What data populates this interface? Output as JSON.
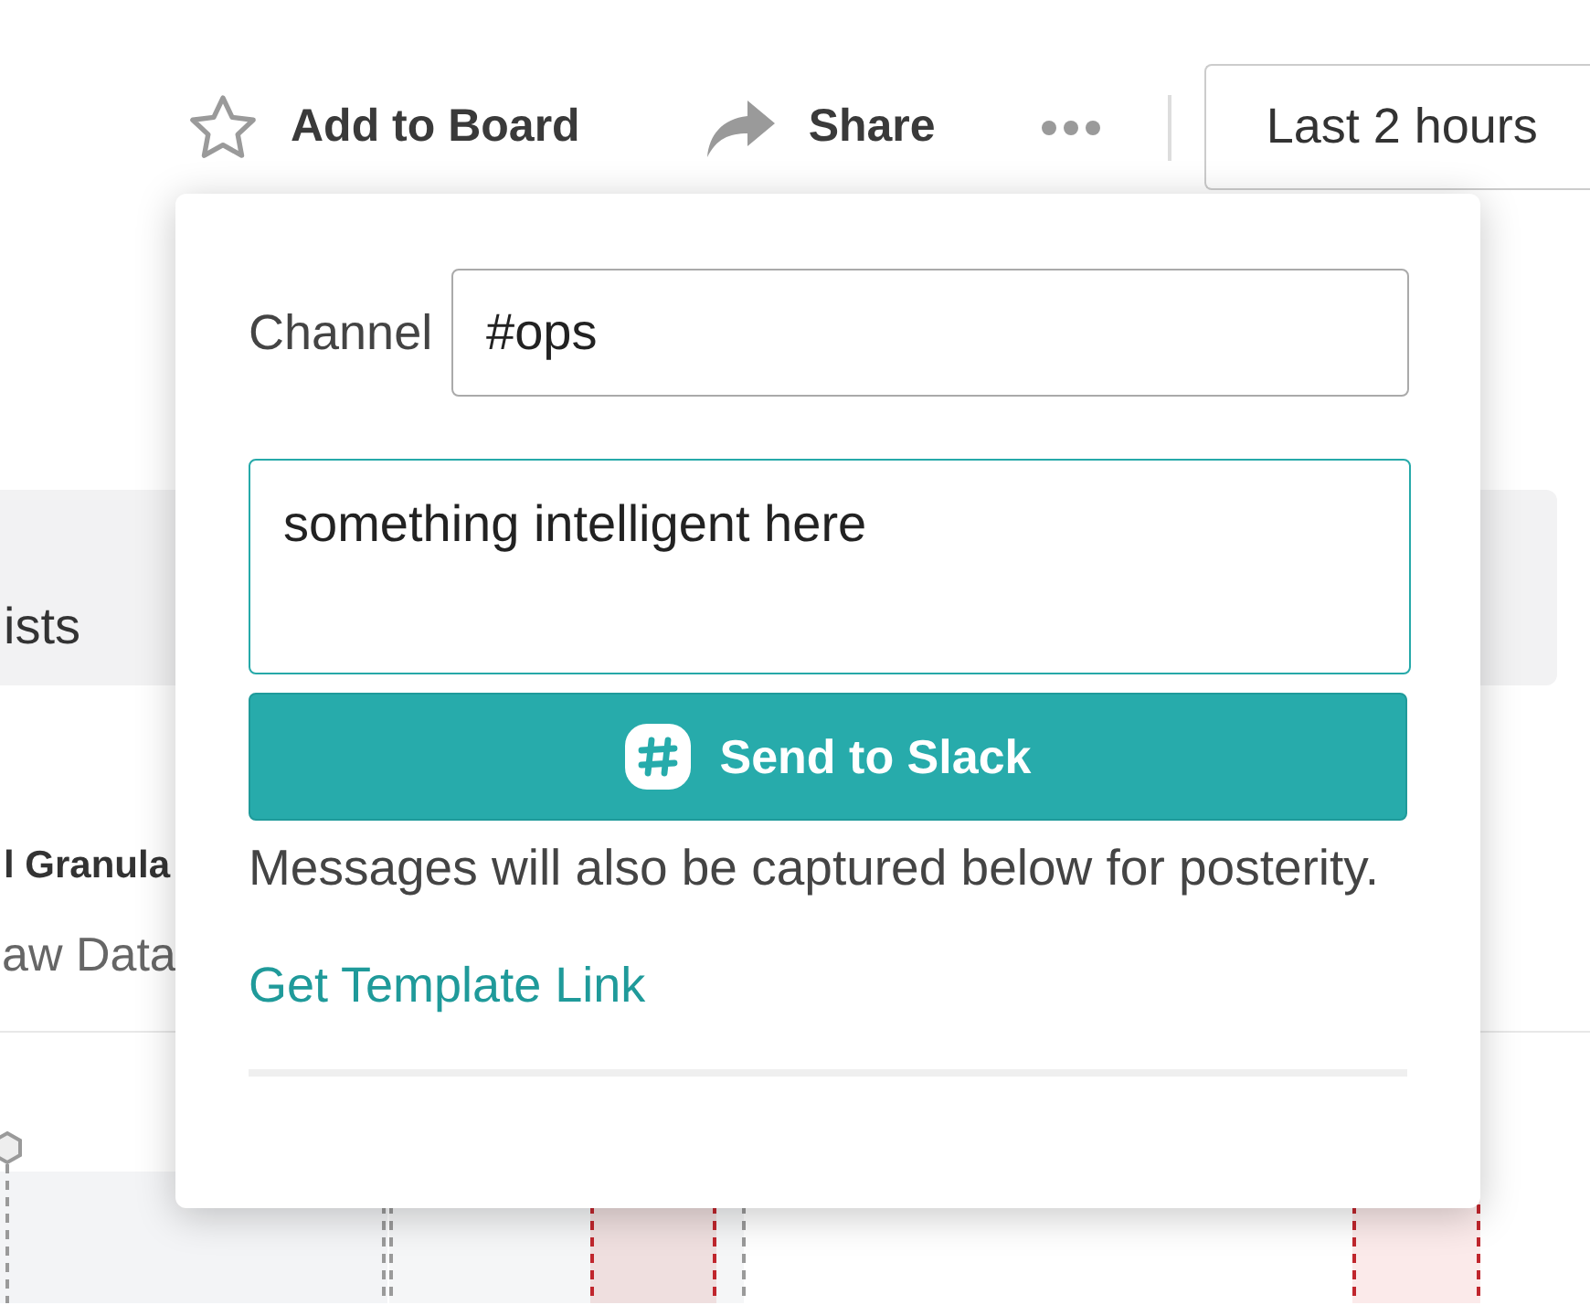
{
  "toolbar": {
    "add_to_board": "Add to Board",
    "share": "Share",
    "time_range": "Last 2 hours"
  },
  "background": {
    "band_text": "ists",
    "section_title": "l Granula",
    "subtitle": "aw Data"
  },
  "share_popover": {
    "channel": {
      "label": "Channel",
      "value": "#ops"
    },
    "message": {
      "value": "something intelligent here",
      "focused": true
    },
    "send_button": "Send to Slack",
    "note": "Messages will also be captured below for posterity.",
    "template_link": "Get Template Link"
  }
}
